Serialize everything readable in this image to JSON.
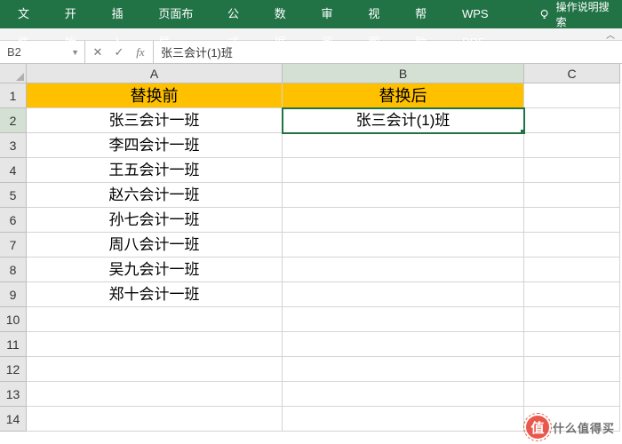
{
  "ribbon": {
    "tabs": [
      "文件",
      "开始",
      "插入",
      "页面布局",
      "公式",
      "数据",
      "审阅",
      "视图",
      "帮助",
      "WPS PDF"
    ],
    "hint": "操作说明搜索"
  },
  "formula_bar": {
    "name_box": "B2",
    "cancel": "✕",
    "confirm": "✓",
    "fx": "fx",
    "formula": "张三会计(1)班"
  },
  "columns": [
    "A",
    "B",
    "C"
  ],
  "header_row": {
    "A": "替换前",
    "B": "替换后"
  },
  "data_rows": [
    {
      "A": "张三会计一班",
      "B": "张三会计(1)班"
    },
    {
      "A": "李四会计一班",
      "B": ""
    },
    {
      "A": "王五会计一班",
      "B": ""
    },
    {
      "A": "赵六会计一班",
      "B": ""
    },
    {
      "A": "孙七会计一班",
      "B": ""
    },
    {
      "A": "周八会计一班",
      "B": ""
    },
    {
      "A": "吴九会计一班",
      "B": ""
    },
    {
      "A": "郑十会计一班",
      "B": ""
    }
  ],
  "total_rows": 14,
  "active_cell": "B2",
  "watermark": {
    "badge": "值",
    "text": "什么值得买"
  }
}
